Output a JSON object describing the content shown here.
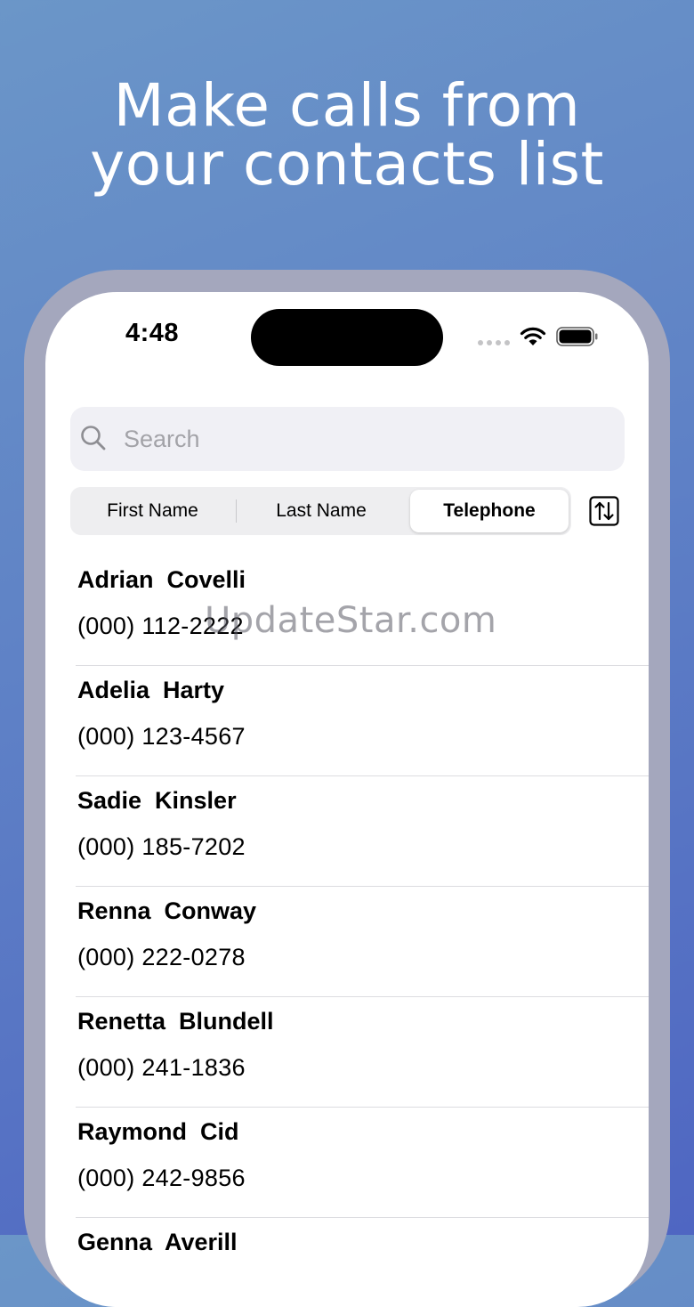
{
  "headline": {
    "line1": "Make calls from",
    "line2": "your contacts list"
  },
  "status_bar": {
    "time": "4:48",
    "icons": [
      "signal-dots-icon",
      "wifi-icon",
      "battery-icon"
    ]
  },
  "search": {
    "placeholder": "Search",
    "value": ""
  },
  "sort_segments": {
    "options": [
      "First Name",
      "Last Name",
      "Telephone"
    ],
    "selected": "Telephone"
  },
  "sort_direction_icon": "sort-arrows-icon",
  "contacts": [
    {
      "name": "Adrian  Covelli",
      "phone": "(000) 112-2222"
    },
    {
      "name": "Adelia  Harty",
      "phone": "(000) 123-4567"
    },
    {
      "name": "Sadie  Kinsler",
      "phone": "(000) 185-7202"
    },
    {
      "name": "Renna  Conway",
      "phone": "(000) 222-0278"
    },
    {
      "name": "Renetta  Blundell",
      "phone": "(000) 241-1836"
    },
    {
      "name": "Raymond  Cid",
      "phone": "(000) 242-9856"
    },
    {
      "name": "Genna  Averill",
      "phone": ""
    }
  ],
  "watermark": "UpdateStar.com",
  "colors": {
    "background_top": "#6b96c8",
    "background_bottom": "#4f66c2",
    "frame": "#a4a7bd",
    "segment_bg": "#eeeef0",
    "search_bg": "#f0f0f5"
  }
}
